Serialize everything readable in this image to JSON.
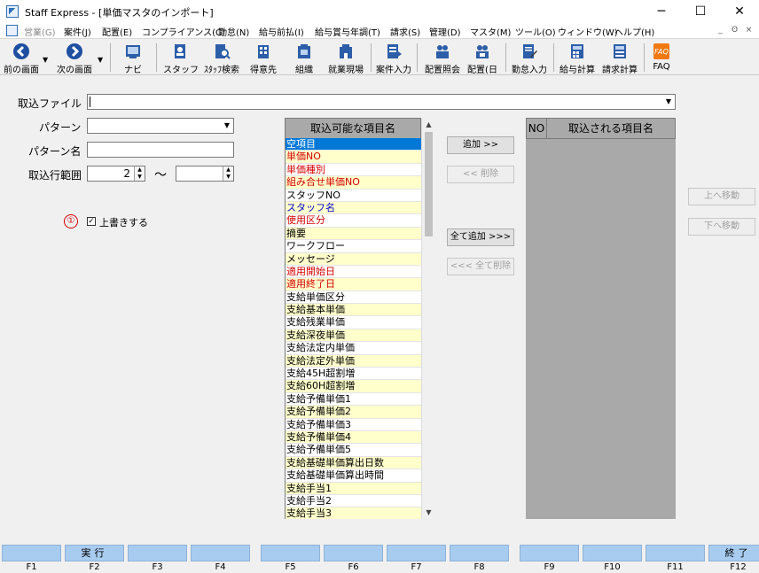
{
  "window": {
    "title": "Staff Express - [単価マスタのインポート]",
    "controls": {
      "minimize": "─",
      "maximize": "☐",
      "close": "✕"
    }
  },
  "menu": {
    "items": [
      {
        "label": "営業(G)",
        "disabled": true
      },
      {
        "label": "案件(J)"
      },
      {
        "label": "配置(E)"
      },
      {
        "label": "コンプライアンス(C)"
      },
      {
        "label": "勤怠(N)"
      },
      {
        "label": "給与前払(I)"
      },
      {
        "label": "給与賞与年調(T)"
      },
      {
        "label": "請求(S)"
      },
      {
        "label": "管理(D)"
      },
      {
        "label": "マスタ(M)"
      },
      {
        "label": "ツール(O)"
      },
      {
        "label": "ウィンドウ(W)"
      },
      {
        "label": "ヘルプ(H)"
      }
    ],
    "mdi": {
      "minimize": "_",
      "restore": "ʘ",
      "close": "×"
    }
  },
  "toolbar": {
    "items": [
      {
        "label": "前の画面",
        "icon": "back-arrow-icon"
      },
      {
        "label": "次の画面",
        "icon": "forward-arrow-icon"
      },
      {
        "label": "ナビ",
        "icon": "navi-icon"
      },
      {
        "label": "スタッフ",
        "icon": "staff-icon"
      },
      {
        "label": "ｽﾀｯﾌ検索",
        "icon": "staff-search-icon"
      },
      {
        "label": "得意先",
        "icon": "client-icon"
      },
      {
        "label": "組織",
        "icon": "organization-icon"
      },
      {
        "label": "就業現場",
        "icon": "workplace-icon"
      },
      {
        "label": "案件入力",
        "icon": "job-entry-icon"
      },
      {
        "label": "配置照会",
        "icon": "placement-inquiry-icon"
      },
      {
        "label": "配置(日",
        "icon": "placement-daily-icon"
      },
      {
        "label": "勤怠入力",
        "icon": "attendance-entry-icon"
      },
      {
        "label": "給与計算",
        "icon": "payroll-calc-icon"
      },
      {
        "label": "請求計算",
        "icon": "billing-calc-icon"
      },
      {
        "label": "FAQ",
        "icon": "faq-icon"
      }
    ]
  },
  "form": {
    "import_file_label": "取込ファイル",
    "import_file_value": "",
    "pattern_label": "パターン",
    "pattern_value": "",
    "pattern_name_label": "パターン名",
    "pattern_name_value": "",
    "row_range_label": "取込行範囲",
    "row_range_from": "2",
    "row_range_to": "",
    "range_separator": "～",
    "overwrite_marker": "①",
    "overwrite_label": "上書きする",
    "overwrite_checked": "✓"
  },
  "available": {
    "header": "取込可能な項目名",
    "items": [
      {
        "text": "空項目",
        "style": "selected"
      },
      {
        "text": "単価NO",
        "style": "yellow red"
      },
      {
        "text": "単価種別",
        "style": "red"
      },
      {
        "text": "組み合せ単価NO",
        "style": "yellow red"
      },
      {
        "text": "スタッフNO",
        "style": ""
      },
      {
        "text": "スタッフ名",
        "style": "yellow blue"
      },
      {
        "text": "使用区分",
        "style": "red"
      },
      {
        "text": "摘要",
        "style": "yellow"
      },
      {
        "text": "ワークフロー",
        "style": ""
      },
      {
        "text": "メッセージ",
        "style": "yellow"
      },
      {
        "text": "適用開始日",
        "style": "red"
      },
      {
        "text": "適用終了日",
        "style": "yellow red"
      },
      {
        "text": "支給単価区分",
        "style": ""
      },
      {
        "text": "支給基本単価",
        "style": "yellow"
      },
      {
        "text": "支給残業単価",
        "style": ""
      },
      {
        "text": "支給深夜単価",
        "style": "yellow"
      },
      {
        "text": "支給法定内単価",
        "style": ""
      },
      {
        "text": "支給法定外単価",
        "style": "yellow"
      },
      {
        "text": "支給45H超割増",
        "style": ""
      },
      {
        "text": "支給60H超割増",
        "style": "yellow"
      },
      {
        "text": "支給予備単価1",
        "style": ""
      },
      {
        "text": "支給予備単価2",
        "style": "yellow"
      },
      {
        "text": "支給予備単価3",
        "style": ""
      },
      {
        "text": "支給予備単価4",
        "style": "yellow"
      },
      {
        "text": "支給予備単価5",
        "style": ""
      },
      {
        "text": "支給基礎単価算出日数",
        "style": "yellow"
      },
      {
        "text": "支給基礎単価算出時間",
        "style": ""
      },
      {
        "text": "支給手当1",
        "style": "yellow"
      },
      {
        "text": "支給手当2",
        "style": ""
      },
      {
        "text": "支給手当3",
        "style": "yellow"
      }
    ]
  },
  "target": {
    "no_header": "NO",
    "header": "取込される項目名"
  },
  "buttons": {
    "add": "追加 >>",
    "remove": "<< 削除",
    "add_all": "全て追加 >>>",
    "remove_all": "<<< 全て削除",
    "move_up": "上へ移動",
    "move_down": "下へ移動"
  },
  "fkeys": [
    {
      "key": "F1",
      "label": ""
    },
    {
      "key": "F2",
      "label": "実行"
    },
    {
      "key": "F3",
      "label": ""
    },
    {
      "key": "F4",
      "label": ""
    },
    {
      "key": "F5",
      "label": ""
    },
    {
      "key": "F6",
      "label": ""
    },
    {
      "key": "F7",
      "label": ""
    },
    {
      "key": "F8",
      "label": ""
    },
    {
      "key": "F9",
      "label": ""
    },
    {
      "key": "F10",
      "label": ""
    },
    {
      "key": "F11",
      "label": ""
    },
    {
      "key": "F12",
      "label": "終了"
    }
  ],
  "colors": {
    "selected": "#0078d7",
    "required": "#d40000",
    "linked": "#0000cc",
    "alt_row": "#ffffcc",
    "fkey": "#a8ccf0"
  }
}
